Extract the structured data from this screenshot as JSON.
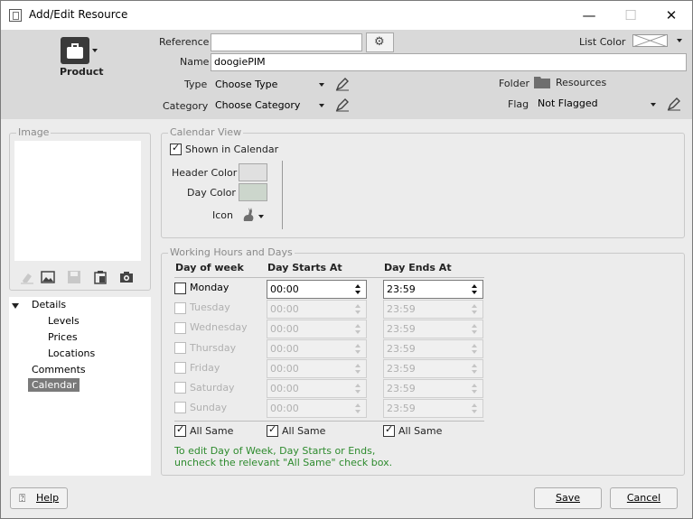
{
  "window": {
    "title": "Add/Edit Resource",
    "minimize_glyph": "—",
    "maximize_glyph": "☐",
    "close_glyph": "✕"
  },
  "header": {
    "type_button_label": "Product",
    "reference_label": "Reference",
    "reference_value": "",
    "name_label": "Name",
    "name_value": "doogiePIM",
    "type_label": "Type",
    "type_value": "Choose Type",
    "category_label": "Category",
    "category_value": "Choose Category",
    "list_color_label": "List Color",
    "folder_label": "Folder",
    "folder_value": "Resources",
    "flag_label": "Flag",
    "flag_value": "Not Flagged"
  },
  "image_panel": {
    "title": "Image"
  },
  "nav": {
    "items": [
      {
        "label": "Details"
      },
      {
        "label": "Levels"
      },
      {
        "label": "Prices"
      },
      {
        "label": "Locations"
      },
      {
        "label": "Comments"
      },
      {
        "label": "Calendar"
      }
    ]
  },
  "calendar_view": {
    "title": "Calendar View",
    "shown_label": "Shown in Calendar",
    "header_color_label": "Header Color",
    "day_color_label": "Day Color",
    "icon_label": "Icon",
    "header_color": "#e0e0e0",
    "day_color": "#ccd6cc"
  },
  "working_hours": {
    "title": "Working Hours and Days",
    "col_day": "Day of week",
    "col_start": "Day Starts At",
    "col_end": "Day Ends At",
    "rows": [
      {
        "day": "Monday",
        "start": "00:00",
        "end": "23:59"
      },
      {
        "day": "Tuesday",
        "start": "00:00",
        "end": "23:59"
      },
      {
        "day": "Wednesday",
        "start": "00:00",
        "end": "23:59"
      },
      {
        "day": "Thursday",
        "start": "00:00",
        "end": "23:59"
      },
      {
        "day": "Friday",
        "start": "00:00",
        "end": "23:59"
      },
      {
        "day": "Saturday",
        "start": "00:00",
        "end": "23:59"
      },
      {
        "day": "Sunday",
        "start": "00:00",
        "end": "23:59"
      }
    ],
    "all_same_label": "All Same",
    "note_line1": "To edit Day of Week, Day Starts or Ends,",
    "note_line2": "uncheck the relevant \"All Same\" check box."
  },
  "buttons": {
    "help": "Help",
    "save": "Save",
    "cancel": "Cancel"
  }
}
